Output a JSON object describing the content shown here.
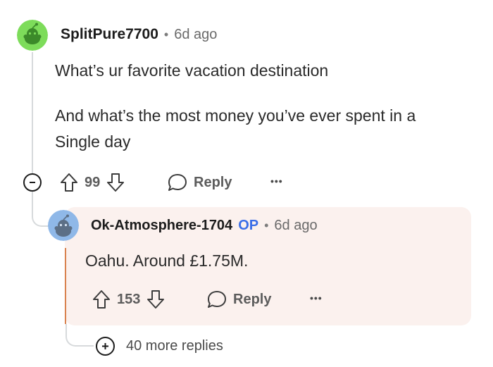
{
  "parent": {
    "username": "SplitPure7700",
    "time": "6d ago",
    "body_line1": "What’s ur favorite vacation destination",
    "body_line2": "And what’s the most money you’ve ever spent in a",
    "body_line3": "Single day",
    "votes": "99",
    "reply_label": "Reply",
    "more_label": "•••",
    "avatar_color": "#7ddc5a"
  },
  "reply": {
    "username": "Ok-Atmosphere-1704",
    "op_label": "OP",
    "time": "6d ago",
    "body": "Oahu. Around £1.75M.",
    "votes": "153",
    "reply_label": "Reply",
    "more_label": "•••",
    "avatar_color": "#8fb8e8",
    "panel_color": "#fbf1ee",
    "op_bar_color": "#d9824f"
  },
  "more_replies": {
    "label": "40 more replies"
  },
  "separator": "•"
}
